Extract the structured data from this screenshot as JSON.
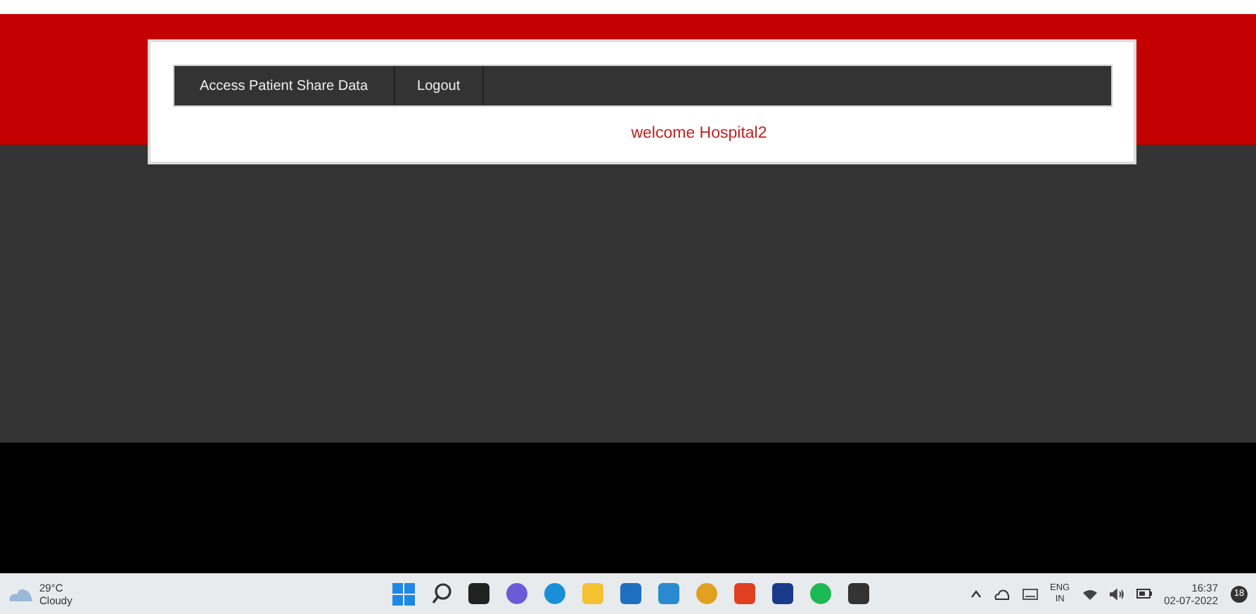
{
  "nav": {
    "items": [
      {
        "label": "Access Patient Share Data"
      },
      {
        "label": "Logout"
      }
    ]
  },
  "welcome": "welcome Hospital2",
  "taskbar": {
    "weather": {
      "temp": "29°C",
      "condition": "Cloudy"
    },
    "apps": [
      {
        "kind": "start"
      },
      {
        "kind": "search"
      },
      {
        "kind": "tile",
        "color": "#222222"
      },
      {
        "kind": "round",
        "color": "#6b5bd6"
      },
      {
        "kind": "round",
        "color": "#1a8fd8"
      },
      {
        "kind": "tile",
        "color": "#f2c230"
      },
      {
        "kind": "tile",
        "color": "#1f6fc0"
      },
      {
        "kind": "tile",
        "color": "#2a8ad0"
      },
      {
        "kind": "round",
        "color": "#e0a020"
      },
      {
        "kind": "tile",
        "color": "#e04020"
      },
      {
        "kind": "tile",
        "color": "#1a3a8a"
      },
      {
        "kind": "round",
        "color": "#1db954"
      },
      {
        "kind": "tile",
        "color": "#333333"
      }
    ],
    "lang": "ENG",
    "region": "IN",
    "time": "16:37",
    "date": "02-07-2022",
    "badge": "18"
  }
}
